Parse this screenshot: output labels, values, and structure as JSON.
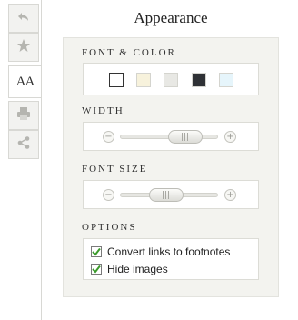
{
  "tabs": [
    {
      "icon": "back-arrow-icon"
    },
    {
      "icon": "star-icon"
    },
    {
      "label": "AA",
      "active": true
    },
    {
      "icon": "print-icon"
    },
    {
      "icon": "share-icon"
    }
  ],
  "title": "Appearance",
  "font_color": {
    "label": "FONT & COLOR",
    "swatches": [
      "#ffffff",
      "#f7f2dc",
      "#e8e8e4",
      "#2f3236",
      "#e6f5fb"
    ],
    "selected_index": 0
  },
  "width": {
    "label": "WIDTH",
    "minus": "−",
    "plus": "+",
    "level": 0.75
  },
  "font_size": {
    "label": "FONT SIZE",
    "minus": "−",
    "plus": "+",
    "level": 0.45
  },
  "options": {
    "label": "OPTIONS",
    "items": [
      {
        "label": "Convert links to footnotes",
        "checked": true
      },
      {
        "label": "Hide images",
        "checked": true
      }
    ]
  },
  "colors": {
    "check": "#3a9a2a"
  }
}
